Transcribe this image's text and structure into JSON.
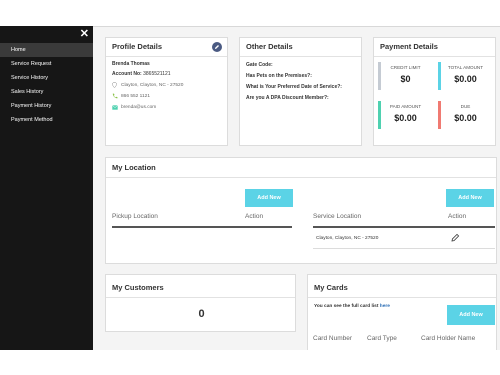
{
  "sidebar": {
    "close_label": "✕",
    "items": [
      {
        "label": "Home",
        "active": true
      },
      {
        "label": "Service Request",
        "active": false
      },
      {
        "label": "Service History",
        "active": false
      },
      {
        "label": "Sales History",
        "active": false
      },
      {
        "label": "Payment History",
        "active": false
      },
      {
        "label": "Payment Method",
        "active": false
      }
    ]
  },
  "profile": {
    "title": "Profile Details",
    "name": "Brenda Thomas",
    "account_label": "Account No:",
    "account_no": "3865521121",
    "address": "Clayton, Clayton, NC - 27520",
    "phone": "866 552 1121",
    "email": "brenda@us.com"
  },
  "other": {
    "title": "Other Details",
    "lines": [
      "Gate Code:",
      "Has Pets on the Premises?:",
      "What is Your Preferred Date of Service?:",
      "Are you A DPA Discount Member?:"
    ]
  },
  "payment": {
    "title": "Payment Details",
    "stats": [
      {
        "label": "CREDIT LIMIT",
        "value": "$0",
        "color": "#c5cbd3"
      },
      {
        "label": "TOTAL AMOUNT",
        "value": "$0.00",
        "color": "#5bd3e6"
      },
      {
        "label": "PAID AMOUNT",
        "value": "$0.00",
        "color": "#4fd1b0"
      },
      {
        "label": "DUE",
        "value": "$0.00",
        "color": "#f07a72"
      }
    ]
  },
  "location": {
    "title": "My Location",
    "add_label": "Add New",
    "pickup_header": "Pickup Location",
    "action_header": "Action",
    "service_header": "Service Location",
    "service_row": "Clayton, Clayton, NC - 27520"
  },
  "customers": {
    "title": "My Customers",
    "count": "0"
  },
  "cards": {
    "title": "My Cards",
    "note": "You can see the full card list",
    "link": "here",
    "add_label": "Add New",
    "headers": [
      "Card Number",
      "Card Type",
      "Card Holder Name"
    ]
  },
  "colors": {
    "accent": "#5bd3e6",
    "sidebar_bg": "#161616",
    "edit_icon_bg": "#4a5a82"
  }
}
